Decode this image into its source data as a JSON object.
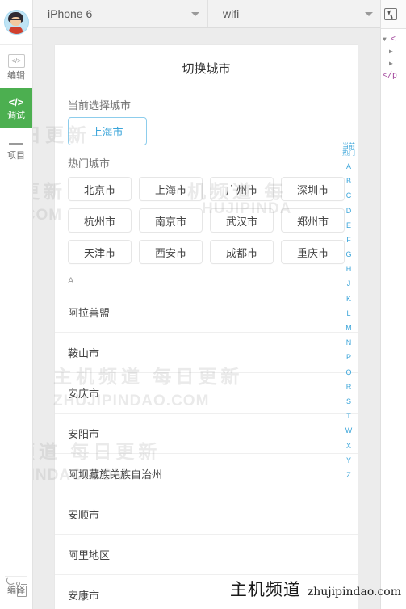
{
  "sidebar": {
    "avatar_name": "user-avatar",
    "items": [
      {
        "icon": "code-box-icon",
        "label": "编辑",
        "active": false
      },
      {
        "icon": "code-slash-icon",
        "label": "调试",
        "active": true
      },
      {
        "icon": "project-lines-icon",
        "label": "项目",
        "active": false
      }
    ],
    "bottom_item": {
      "icon": "compile-icon",
      "label": "编译"
    }
  },
  "toolbar": {
    "device_select": {
      "value": "iPhone 6",
      "caret": "chevron-down-icon"
    },
    "network_select": {
      "value": "wifi",
      "caret": "chevron-down-icon"
    },
    "inspect_tool": "select-element-icon"
  },
  "simulator": {
    "page_title": "切换城市",
    "current_section_label": "当前选择城市",
    "current_city": "上海市",
    "hot_section_label": "热门城市",
    "hot_cities": [
      "北京市",
      "上海市",
      "广州市",
      "深圳市",
      "杭州市",
      "南京市",
      "武汉市",
      "郑州市",
      "天津市",
      "西安市",
      "成都市",
      "重庆市"
    ],
    "alpha_group": "A",
    "city_list": [
      "阿拉善盟",
      "鞍山市",
      "安庆市",
      "安阳市",
      "阿坝藏族羌族自治州",
      "安顺市",
      "阿里地区",
      "安康市"
    ],
    "index_bar": {
      "top_labels": [
        "当前",
        "热门"
      ],
      "letters": [
        "A",
        "B",
        "C",
        "D",
        "E",
        "F",
        "G",
        "H",
        "J",
        "K",
        "L",
        "M",
        "N",
        "P",
        "Q",
        "R",
        "S",
        "T",
        "W",
        "X",
        "Y",
        "Z"
      ]
    }
  },
  "devtools": {
    "tree": [
      {
        "twisty": "▼",
        "text": "<"
      },
      {
        "twisty": "▶",
        "text": ""
      },
      {
        "twisty": "▶",
        "text": ""
      },
      {
        "twisty": "",
        "text": "</p"
      }
    ]
  },
  "watermarks": {
    "cn": "主机频道 每日更新",
    "en": "ZHUJIPINDAO.COM",
    "short_cn": "每日更新",
    "short_en": "IDAO.COM",
    "frag_cn": "机频道 每",
    "frag_en": "HUJIPINDA"
  },
  "brand": {
    "cn": "主机频道",
    "en": "zhujipindao.com"
  },
  "colors": {
    "accent_green": "#4caf50",
    "accent_blue": "#3ba5da",
    "stage_bg": "#ececec",
    "toolbar_bg": "#f2f2f2"
  }
}
